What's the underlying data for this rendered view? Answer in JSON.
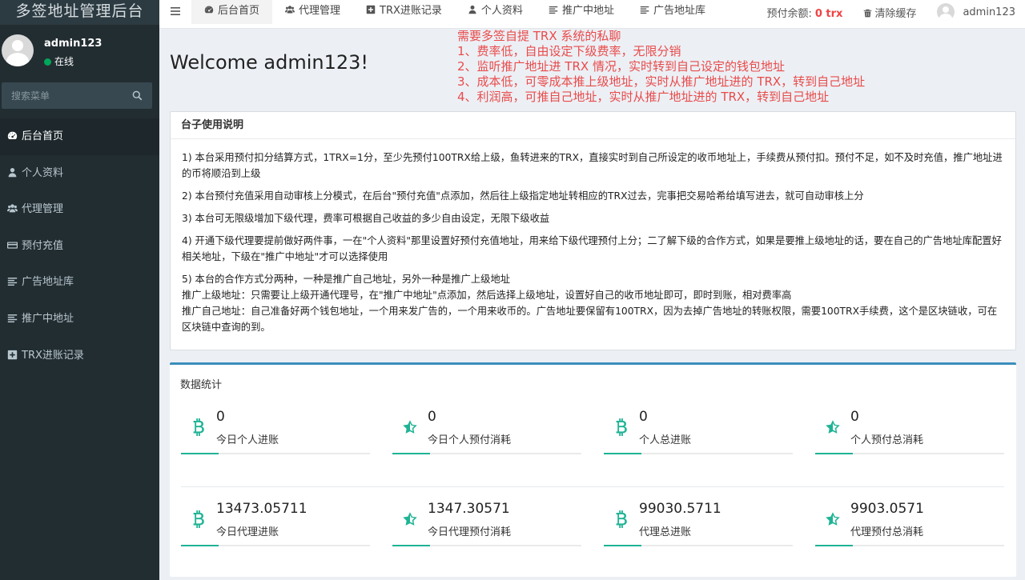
{
  "sidebar": {
    "brand": "多签地址管理后台",
    "user": {
      "name": "admin123",
      "status": "在线"
    },
    "search_placeholder": "搜索菜单",
    "items": [
      {
        "label": "后台首页",
        "icon": "dashboard-icon",
        "active": true
      },
      {
        "label": "个人资料",
        "icon": "user-icon"
      },
      {
        "label": "代理管理",
        "icon": "users-icon"
      },
      {
        "label": "预付充值",
        "icon": "credit-card-icon"
      },
      {
        "label": "广告地址库",
        "icon": "list-icon"
      },
      {
        "label": "推广中地址",
        "icon": "list-icon"
      },
      {
        "label": "TRX进账记录",
        "icon": "plus-square-icon"
      }
    ]
  },
  "header": {
    "tabs": [
      {
        "label": "后台首页",
        "icon": "dashboard-icon",
        "active": true
      },
      {
        "label": "代理管理",
        "icon": "users-icon"
      },
      {
        "label": "TRX进账记录",
        "icon": "plus-square-icon"
      },
      {
        "label": "个人资料",
        "icon": "user-icon"
      },
      {
        "label": "推广中地址",
        "icon": "list-icon"
      },
      {
        "label": "广告地址库",
        "icon": "list-icon"
      }
    ],
    "balance_label": "预付余额:",
    "balance_value": "0 trx",
    "clear_cache": "清除缓存",
    "username": "admin123"
  },
  "main": {
    "welcome": "Welcome admin123!",
    "notes": [
      "需要多签自提 TRX 系统的私聊",
      "1、费率低，自由设定下级费率，无限分销",
      "2、监听推广地址进 TRX 情况，实时转到自己设定的钱包地址",
      "3、成本低，可零成本推上级地址，实时从推广地址进的 TRX，转到自己地址",
      "4、利润高，可推自己地址，实时从推广地址进的 TRX，转到自己地址"
    ],
    "instructions": {
      "title": "台子使用说明",
      "paragraphs": [
        "1) 本台采用预付扣分结算方式，1TRX=1分，至少先预付100TRX给上级，鱼转进来的TRX，直接实时到自己所设定的收币地址上，手续费从预付扣。预付不足，如不及时充值，推广地址进的币将顺沿到上级",
        "2) 本台预付充值采用自动审核上分模式，在后台\"预付充值\"点添加，然后往上级指定地址转相应的TRX过去，完事把交易哈希给填写进去，就可自动审核上分",
        "3) 本台可无限级增加下级代理，费率可根据自己收益的多少自由设定，无限下级收益",
        "4) 开通下级代理要提前做好两件事，一在\"个人资料\"那里设置好预付充值地址，用来给下级代理预付上分；二了解下级的合作方式，如果是要推上级地址的话，要在自己的广告地址库配置好相关地址，下级在\"推广中地址\"才可以选择使用",
        "5) 本台的合作方式分两种，一种是推广自己地址，另外一种是推广上级地址",
        "推广上级地址：只需要让上级开通代理号，在\"推广中地址\"点添加，然后选择上级地址，设置好自己的收币地址即可，即时到账，相对费率高",
        "推广自己地址：自己准备好两个钱包地址，一个用来发广告的，一个用来收币的。广告地址要保留有100TRX，因为去掉广告地址的转账权限，需要100TRX手续费，这个是区块链收，可在区块链中查询的到。"
      ]
    },
    "stats": {
      "title": "数据统计",
      "accent_color": "#1fb394",
      "items": [
        {
          "value": "0",
          "label": "今日个人进账",
          "icon": "bitcoin-icon",
          "progress": 0.2
        },
        {
          "value": "0",
          "label": "今日个人预付消耗",
          "icon": "star-half-icon",
          "progress": 0.2
        },
        {
          "value": "0",
          "label": "个人总进账",
          "icon": "bitcoin-icon",
          "progress": 0.2
        },
        {
          "value": "0",
          "label": "个人预付总消耗",
          "icon": "star-half-icon",
          "progress": 0.2
        },
        {
          "value": "13473.05711",
          "label": "今日代理进账",
          "icon": "bitcoin-icon",
          "progress": 0.2
        },
        {
          "value": "1347.30571",
          "label": "今日代理预付消耗",
          "icon": "star-half-icon",
          "progress": 0.2
        },
        {
          "value": "99030.5711",
          "label": "代理总进账",
          "icon": "bitcoin-icon",
          "progress": 0.2
        },
        {
          "value": "9903.0571",
          "label": "代理预付总消耗",
          "icon": "star-half-icon",
          "progress": 0.2
        }
      ]
    }
  }
}
